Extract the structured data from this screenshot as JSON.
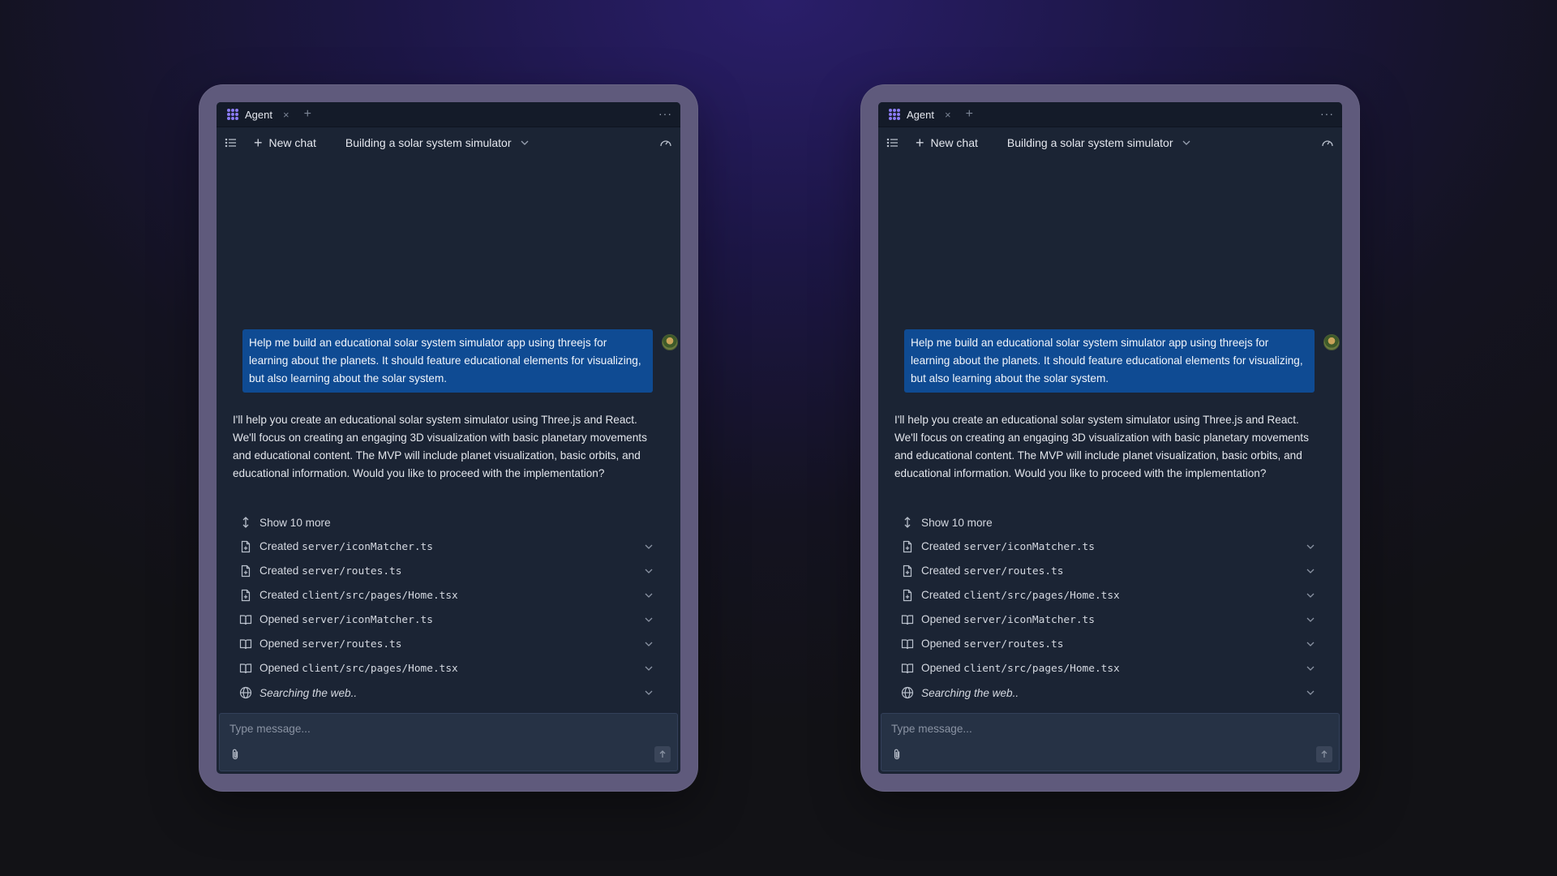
{
  "panels": [
    {
      "tab": {
        "label": "Agent",
        "close": "×",
        "add": "+"
      },
      "more": "···",
      "toolbar": {
        "new_chat": "New chat",
        "chat_title": "Building a solar system simulator"
      },
      "user_message": "Help me build an educational solar system simulator app using threejs for learning about the planets. It should feature educational elements for visualizing, but also learning about the solar system.",
      "assistant_message": "I'll help you create an educational solar system simulator using Three.js and React. We'll focus on creating an engaging 3D visualization with basic planetary movements and educational content. The MVP will include planet visualization, basic orbits, and educational information. Would you like to proceed with the implementation?",
      "show_more": "Show 10 more",
      "actions": [
        {
          "verb": "Created",
          "file": "server/iconMatcher.ts",
          "icon": "file-plus-icon"
        },
        {
          "verb": "Created",
          "file": "server/routes.ts",
          "icon": "file-plus-icon"
        },
        {
          "verb": "Created",
          "file": "client/src/pages/Home.tsx",
          "icon": "file-plus-icon"
        },
        {
          "verb": "Opened",
          "file": "server/iconMatcher.ts",
          "icon": "book-open-icon"
        },
        {
          "verb": "Opened",
          "file": "server/routes.ts",
          "icon": "book-open-icon"
        },
        {
          "verb": "Opened",
          "file": "client/src/pages/Home.tsx",
          "icon": "book-open-icon"
        }
      ],
      "searching": "Searching the web..",
      "composer": {
        "placeholder": "Type message..."
      }
    },
    {
      "tab": {
        "label": "Agent",
        "close": "×",
        "add": "+"
      },
      "more": "···",
      "toolbar": {
        "new_chat": "New chat",
        "chat_title": "Building a solar system simulator"
      },
      "user_message": "Help me build an educational solar system simulator app using threejs for learning about the planets. It should feature educational elements for visualizing, but also learning about the solar system.",
      "assistant_message": "I'll help you create an educational solar system simulator using Three.js and React. We'll focus on creating an engaging 3D visualization with basic planetary movements and educational content. The MVP will include planet visualization, basic orbits, and educational information. Would you like to proceed with the implementation?",
      "show_more": "Show 10 more",
      "actions": [
        {
          "verb": "Created",
          "file": "server/iconMatcher.ts",
          "icon": "file-plus-icon"
        },
        {
          "verb": "Created",
          "file": "server/routes.ts",
          "icon": "file-plus-icon"
        },
        {
          "verb": "Created",
          "file": "client/src/pages/Home.tsx",
          "icon": "file-plus-icon"
        },
        {
          "verb": "Opened",
          "file": "server/iconMatcher.ts",
          "icon": "book-open-icon"
        },
        {
          "verb": "Opened",
          "file": "server/routes.ts",
          "icon": "book-open-icon"
        },
        {
          "verb": "Opened",
          "file": "client/src/pages/Home.tsx",
          "icon": "book-open-icon"
        }
      ],
      "searching": "Searching the web..",
      "composer": {
        "placeholder": "Type message..."
      }
    }
  ],
  "colors": {
    "background": "#141321",
    "frame": "#5f5a7c",
    "window": "#1b2434",
    "user_bubble": "#0f4b93",
    "composer": "#263245",
    "logo": "#8b7cf6"
  }
}
